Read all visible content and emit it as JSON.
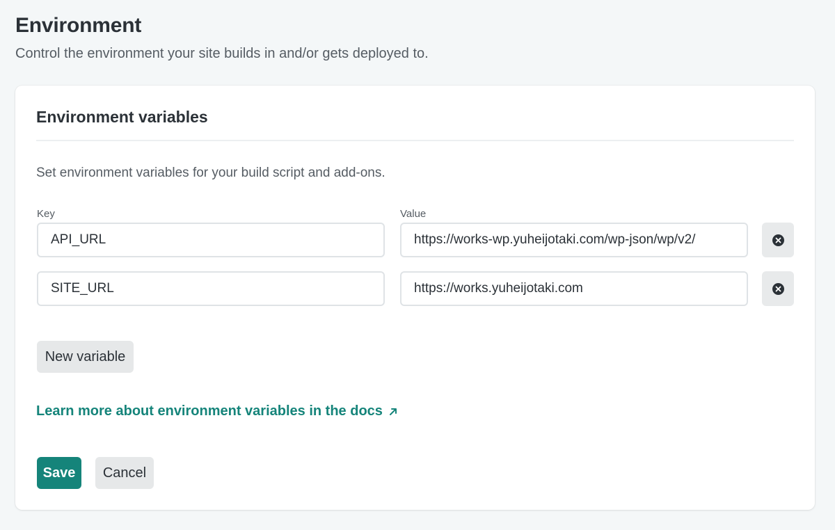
{
  "header": {
    "title": "Environment",
    "subtitle": "Control the environment your site builds in and/or gets deployed to."
  },
  "card": {
    "title": "Environment variables",
    "description": "Set environment variables for your build script and add-ons.",
    "key_label": "Key",
    "value_label": "Value",
    "variables": [
      {
        "key": "API_URL",
        "value": "https://works-wp.yuheijotaki.com/wp-json/wp/v2/"
      },
      {
        "key": "SITE_URL",
        "value": "https://works.yuheijotaki.com"
      }
    ],
    "new_variable_label": "New variable",
    "docs_link_label": "Learn more about environment variables in the docs",
    "save_label": "Save",
    "cancel_label": "Cancel"
  },
  "icons": {
    "remove": "close-circle-icon",
    "external": "arrow-up-right-icon"
  },
  "colors": {
    "accent": "#15847a",
    "page_background": "#f4f7f8"
  }
}
